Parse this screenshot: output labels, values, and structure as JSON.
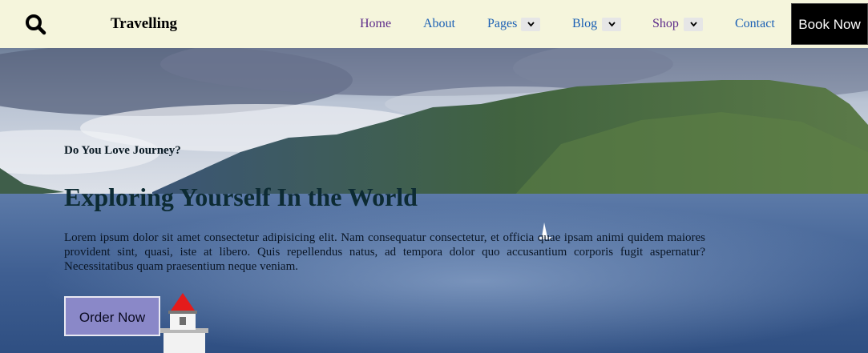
{
  "navbar": {
    "brand": "Travelling",
    "links": [
      {
        "label": "Home"
      },
      {
        "label": "About"
      },
      {
        "label": "Pages"
      },
      {
        "label": "Blog"
      },
      {
        "label": "Shop"
      },
      {
        "label": "Contact"
      }
    ],
    "cta_label": "Book Now"
  },
  "hero": {
    "eyebrow": "Do You Love Journey?",
    "headline": "Exploring Yourself In the World",
    "lead": "Lorem ipsum dolor sit amet consectetur adipisicing elit. Nam consequatur consectetur, et officia quae ipsam animi quidem maiores provident sint, quasi, iste at libero. Quis repellendus natus, ad tempora dolor quo accusantium corporis fugit aspernatur? Necessitatibus quam praesentium neque veniam.",
    "cta_label": "Order Now"
  },
  "colors": {
    "nav_bg": "#f5f5dc",
    "book_bg": "#000000",
    "order_bg": "#8a88c8",
    "link_visited": "#5c2a8a",
    "link": "#1a5fb4"
  },
  "icons": [
    "search-icon",
    "chevron-down-icon"
  ]
}
